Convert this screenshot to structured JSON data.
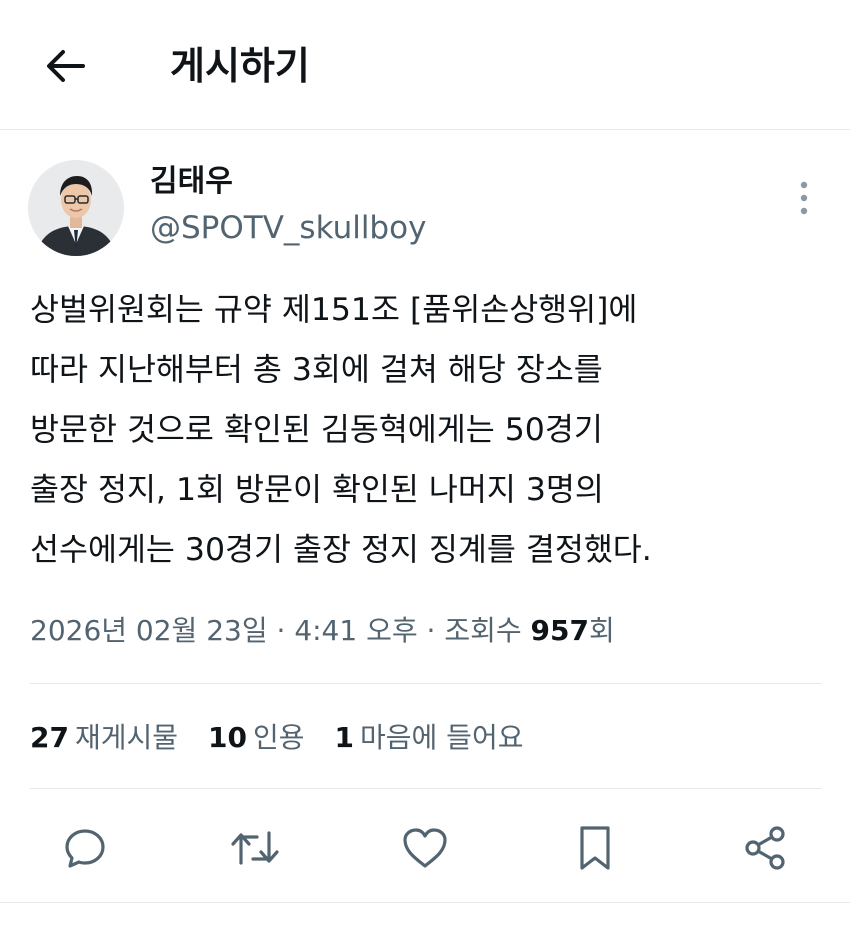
{
  "header": {
    "title": "게시하기",
    "back_icon": "arrow-left-icon"
  },
  "author": {
    "name": "김태우",
    "handle": "@SPOTV_skullboy",
    "avatar_icon": "person-avatar"
  },
  "post": {
    "lines": [
      "상벌위원회는 규약 제151조 [품위손상행위]에",
      "따라 지난해부터 총 3회에 걸쳐 해당 장소를",
      "방문한 것으로 확인된 김동혁에게는 50경기",
      "출장 정지, 1회 방문이 확인된 나머지 3명의",
      "선수에게는 30경기 출장 정지 징계를 결정했다."
    ]
  },
  "meta": {
    "date": "2026년 02월 23일",
    "separator": " · ",
    "time": "4:41 오후",
    "views_label": "조회수",
    "views_count": "957",
    "views_suffix": "회"
  },
  "stats": {
    "reposts_count": "27",
    "reposts_label": "재게시물",
    "quotes_count": "10",
    "quotes_label": "인용",
    "likes_count": "1",
    "likes_label": "마음에 들어요"
  },
  "actions": {
    "icons": [
      "reply-icon",
      "repost-icon",
      "like-icon",
      "bookmark-icon",
      "share-icon"
    ]
  },
  "colors": {
    "text": "#0f1419",
    "secondary": "#536471",
    "divider": "#e7e9ea"
  }
}
